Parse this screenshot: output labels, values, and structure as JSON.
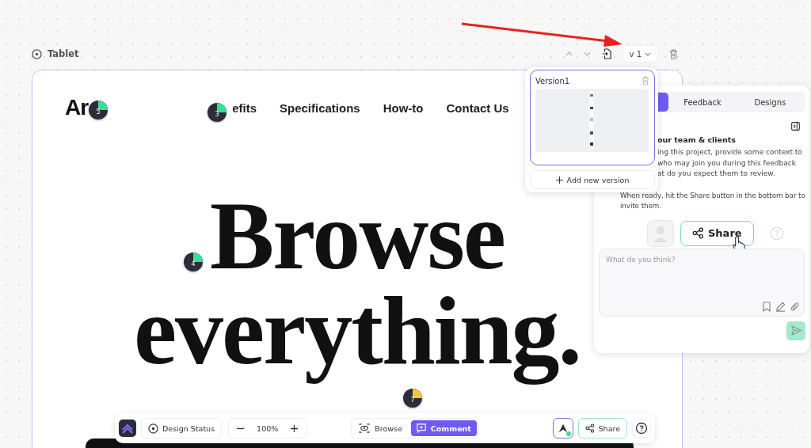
{
  "header": {
    "device": "Tablet",
    "version": "v 1"
  },
  "page": {
    "logo": "Ar",
    "nav": [
      "efits",
      "Specifications",
      "How-to",
      "Contact Us"
    ],
    "headline": [
      "Browse",
      "everything."
    ]
  },
  "pins": [
    {
      "number": "5",
      "color": "#3ddc97"
    },
    {
      "number": "3",
      "color": "#3ddc97"
    },
    {
      "number": "4",
      "color": "#3ddc97"
    },
    {
      "number": "7",
      "color": "#f5c542"
    }
  ],
  "versions_popup": {
    "versions": [
      {
        "name": "Version1",
        "selected": true
      }
    ],
    "add_button": "Add new version"
  },
  "panel": {
    "tabs": [
      {
        "selected": true
      },
      {
        "label": "Feedback",
        "selected": false
      },
      {
        "label": "Designs",
        "selected": false
      }
    ],
    "heading": "our team & clients",
    "body": [
      "ing this project, provide some context to",
      "who may join you during this feedback",
      "at do you expect them to review."
    ],
    "note": "When ready, hit the Share button in the bottom bar to invite them.",
    "illustration_button": "Share",
    "comment": {
      "placeholder": "What do you think?"
    }
  },
  "toolbar": {
    "design_status": "Design Status",
    "zoom": "100%",
    "modes": [
      {
        "label": "Browse",
        "selected": false
      },
      {
        "label": "Comment",
        "selected": true
      }
    ],
    "share": "Share"
  }
}
